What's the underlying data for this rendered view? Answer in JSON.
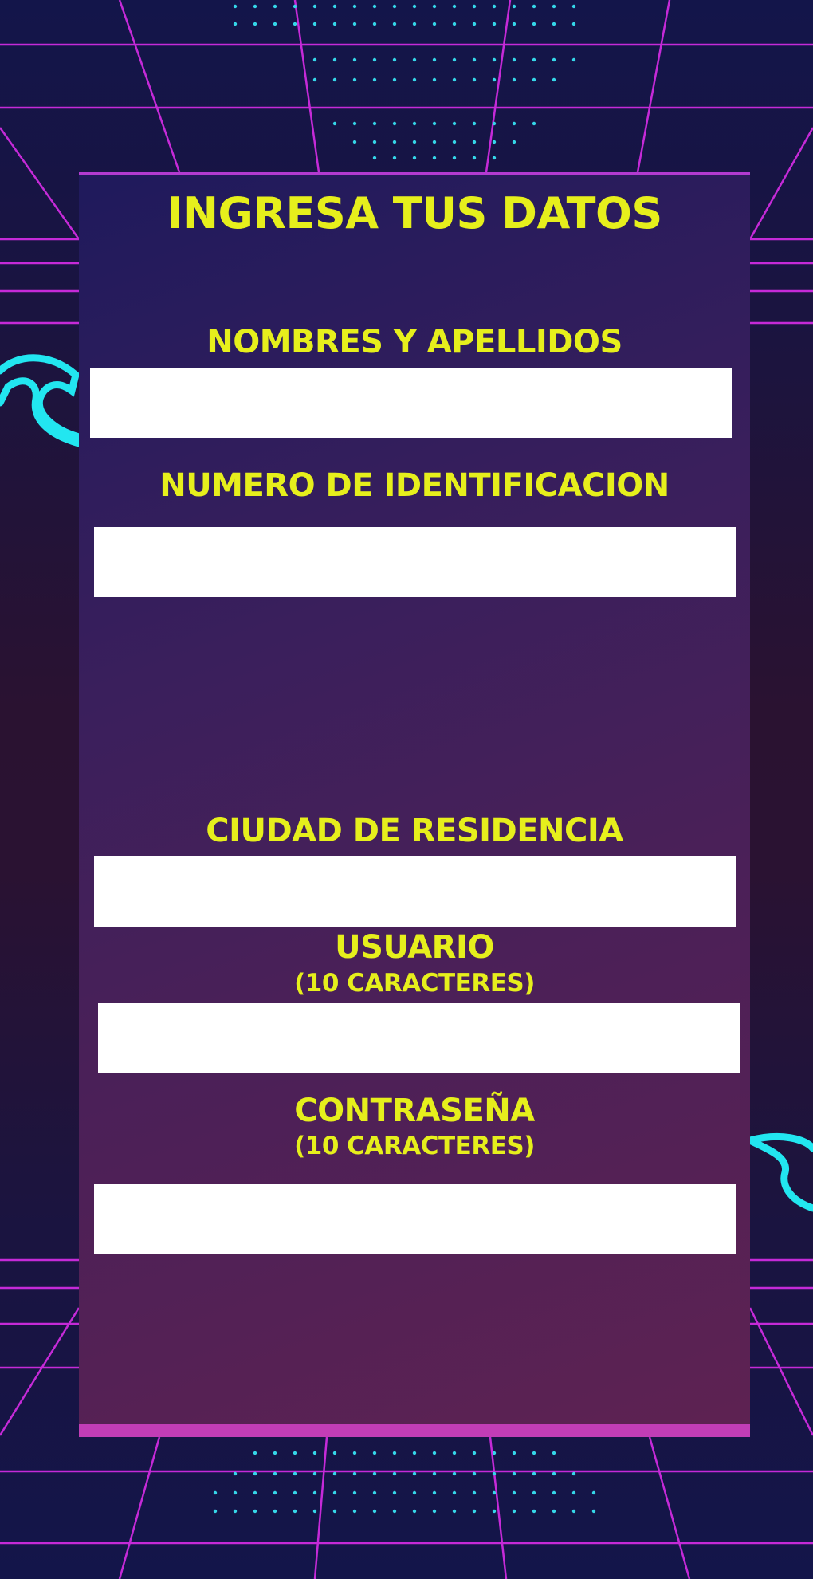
{
  "colors": {
    "title": "#e6ef1c",
    "card_top": "#1f1a5c",
    "card_bottom": "#5e2252",
    "grid_lines": "#c52ad8",
    "neon_accent": "#22e6f0",
    "bottom_bar": "#c23db6"
  },
  "form": {
    "title": "INGRESA TUS DATOS",
    "fields": [
      {
        "label": "NOMBRES Y APELLIDOS",
        "sublabel": "",
        "value": ""
      },
      {
        "label": "NUMERO DE IDENTIFICACION",
        "sublabel": "",
        "value": ""
      },
      {
        "label": "CIUDAD DE RESIDENCIA",
        "sublabel": "",
        "value": ""
      },
      {
        "label": "USUARIO",
        "sublabel": "(10 CARACTERES)",
        "value": ""
      },
      {
        "label": "CONTRASEÑA",
        "sublabel": "(10 CARACTERES)",
        "value": ""
      }
    ]
  }
}
